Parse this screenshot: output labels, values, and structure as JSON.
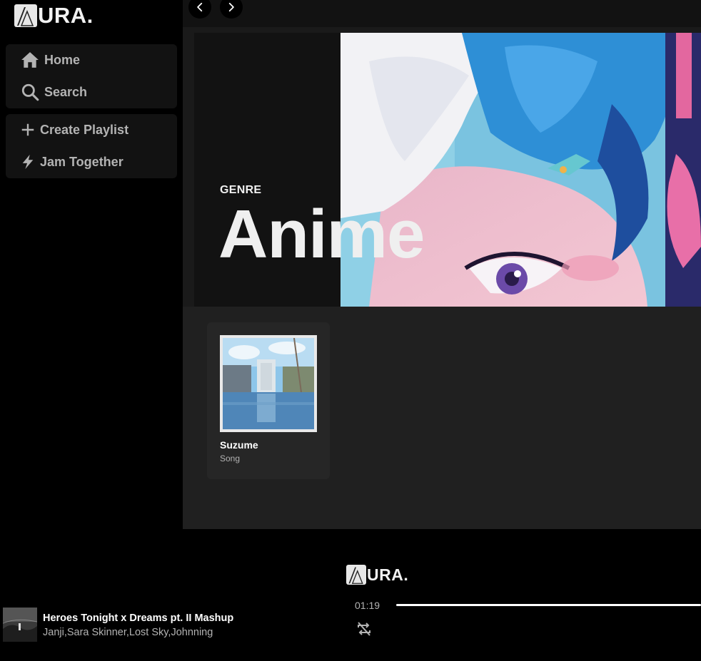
{
  "app": {
    "logo_text": "URA."
  },
  "sidebar": {
    "primary": [
      {
        "label": "Home",
        "icon": "home-icon"
      },
      {
        "label": "Search",
        "icon": "search-icon"
      }
    ],
    "secondary": [
      {
        "label": "Create Playlist",
        "icon": "plus-icon"
      },
      {
        "label": "Jam Together",
        "icon": "lightning-icon"
      }
    ]
  },
  "topbar": {
    "back_icon": "chevron-left-icon",
    "forward_icon": "chevron-right-icon"
  },
  "hero": {
    "label": "GENRE",
    "title": "Anime"
  },
  "items": [
    {
      "title": "Suzume",
      "subtitle": "Song"
    }
  ],
  "player": {
    "logo_text": "URA.",
    "track_title": "Heroes Tonight x Dreams pt. II Mashup",
    "track_artists": "Janji,Sara Skinner,Lost Sky,Johnning",
    "elapsed": "01:19",
    "repeat_icon": "repeat-off-icon"
  },
  "colors": {
    "background": "#000000",
    "panel": "#121212",
    "main": "#1a1a1a",
    "muted_text": "#b3b3b3"
  }
}
